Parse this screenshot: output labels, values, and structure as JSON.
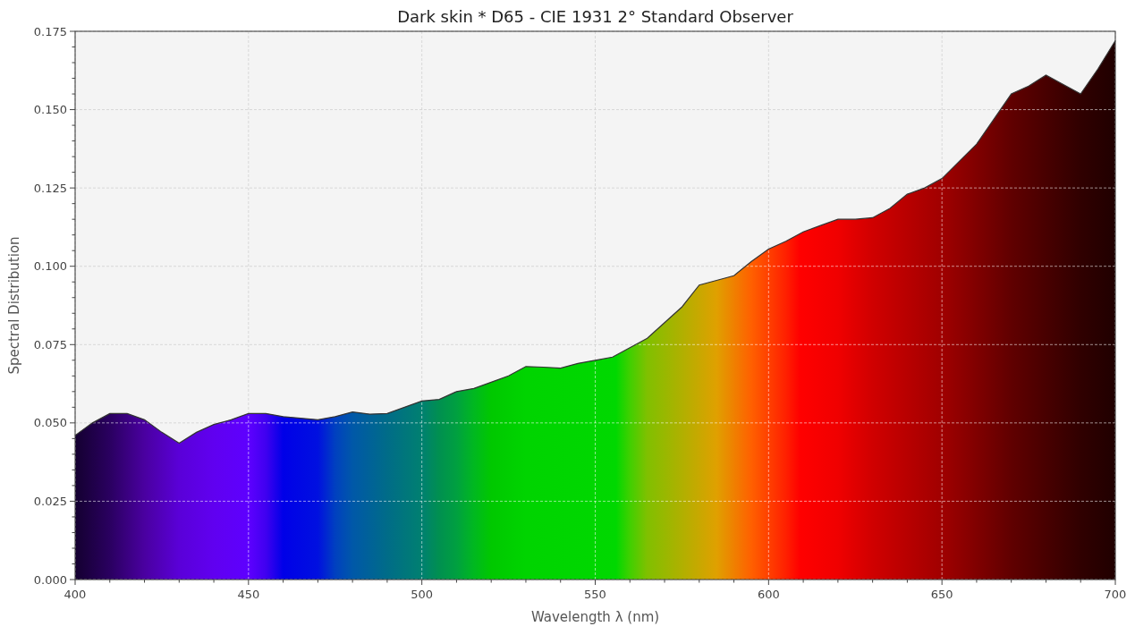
{
  "chart": {
    "chart_data": {
      "type": "area",
      "title": "Dark skin * D65 - CIE 1931 2° Standard Observer",
      "xlabel": "Wavelength λ (nm)",
      "ylabel": "Spectral Distribution",
      "xlim": [
        400,
        700
      ],
      "ylim": [
        0,
        0.175
      ],
      "xticks": [
        400,
        450,
        500,
        550,
        600,
        650,
        700
      ],
      "yticks": [
        {
          "value": 0,
          "label": "0.000"
        },
        {
          "value": 0.025,
          "label": "0.025"
        },
        {
          "value": 0.05,
          "label": "0.050"
        },
        {
          "value": 0.075,
          "label": "0.075"
        },
        {
          "value": 0.1,
          "label": "0.100"
        },
        {
          "value": 0.125,
          "label": "0.125"
        },
        {
          "value": 0.15,
          "label": "0.150"
        },
        {
          "value": 0.175,
          "label": "0.175"
        }
      ],
      "x": [
        400,
        405,
        410,
        415,
        420,
        425,
        430,
        435,
        440,
        445,
        450,
        455,
        460,
        465,
        470,
        475,
        480,
        485,
        490,
        495,
        500,
        505,
        510,
        515,
        520,
        525,
        530,
        535,
        540,
        545,
        550,
        555,
        560,
        565,
        570,
        575,
        580,
        585,
        590,
        595,
        600,
        605,
        610,
        615,
        620,
        625,
        630,
        635,
        640,
        645,
        650,
        655,
        660,
        665,
        670,
        675,
        680,
        685,
        690,
        695,
        700
      ],
      "grid": true,
      "series": [
        {
          "color": "#333333",
          "values": [
            0.046,
            0.05,
            0.053,
            0.053,
            0.051,
            0.047,
            0.0435,
            0.047,
            0.0495,
            0.051,
            0.053,
            0.053,
            0.052,
            0.0515,
            0.051,
            0.052,
            0.0535,
            0.0528,
            0.053,
            0.055,
            0.057,
            0.0575,
            0.06,
            0.061,
            0.063,
            0.065,
            0.068,
            0.0678,
            0.0675,
            0.069,
            0.07,
            0.071,
            0.074,
            0.077,
            0.082,
            0.087,
            0.094,
            0.0955,
            0.097,
            0.1015,
            0.1055,
            0.108,
            0.111,
            0.113,
            0.115,
            0.115,
            0.1155,
            0.1185,
            0.123,
            0.125,
            0.128,
            0.1335,
            0.139,
            0.147,
            0.155,
            0.1575,
            0.161,
            0.158,
            0.155,
            0.163,
            0.172
          ]
        }
      ]
    }
  }
}
